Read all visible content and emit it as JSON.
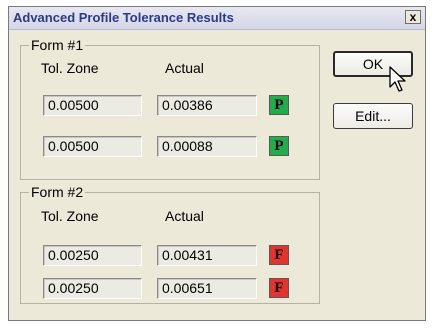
{
  "window": {
    "title": "Advanced Profile Tolerance Results",
    "close_label": "x"
  },
  "groups": [
    {
      "label": "Form #1",
      "col_tol": "Tol. Zone",
      "col_actual": "Actual",
      "rows": [
        {
          "tol": "0.00500",
          "actual": "0.00386",
          "result": "P",
          "status": "pass"
        },
        {
          "tol": "0.00500",
          "actual": "0.00088",
          "result": "P",
          "status": "pass"
        }
      ]
    },
    {
      "label": "Form #2",
      "col_tol": "Tol. Zone",
      "col_actual": "Actual",
      "rows": [
        {
          "tol": "0.00250",
          "actual": "0.00431",
          "result": "F",
          "status": "fail"
        },
        {
          "tol": "0.00250",
          "actual": "0.00651",
          "result": "F",
          "status": "fail"
        }
      ]
    }
  ],
  "buttons": {
    "ok_label": "OK",
    "edit_label": "Edit..."
  },
  "colors": {
    "pass": "#1fae4b",
    "fail": "#e5322c",
    "title_text": "#2b3b8a"
  },
  "icons": {
    "cursor": "mouse-pointer-icon"
  }
}
